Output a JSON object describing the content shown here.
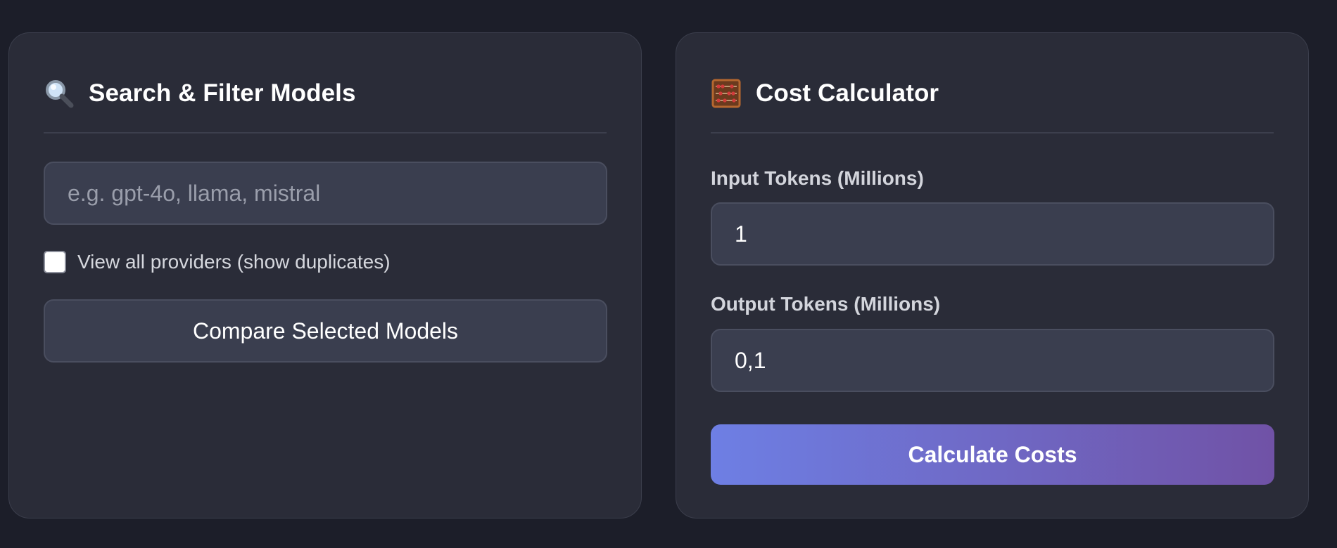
{
  "colors": {
    "page_background": "#1c1e29",
    "panel_background": "#2a2c38",
    "input_background": "#3a3e4f",
    "gradient_start": "#6e7fe4",
    "gradient_end": "#7052a6"
  },
  "search_panel": {
    "icon": "magnifying-glass-icon",
    "title": "Search & Filter Models",
    "search_placeholder": "e.g. gpt-4o, llama, mistral",
    "search_value": "",
    "checkbox_label": "View all providers (show duplicates)",
    "checkbox_checked": false,
    "compare_button_label": "Compare Selected Models"
  },
  "calculator_panel": {
    "icon": "abacus-icon",
    "title": "Cost Calculator",
    "input_tokens_label": "Input Tokens (Millions)",
    "input_tokens_value": "1",
    "output_tokens_label": "Output Tokens (Millions)",
    "output_tokens_value": "0,1",
    "calculate_button_label": "Calculate Costs"
  }
}
